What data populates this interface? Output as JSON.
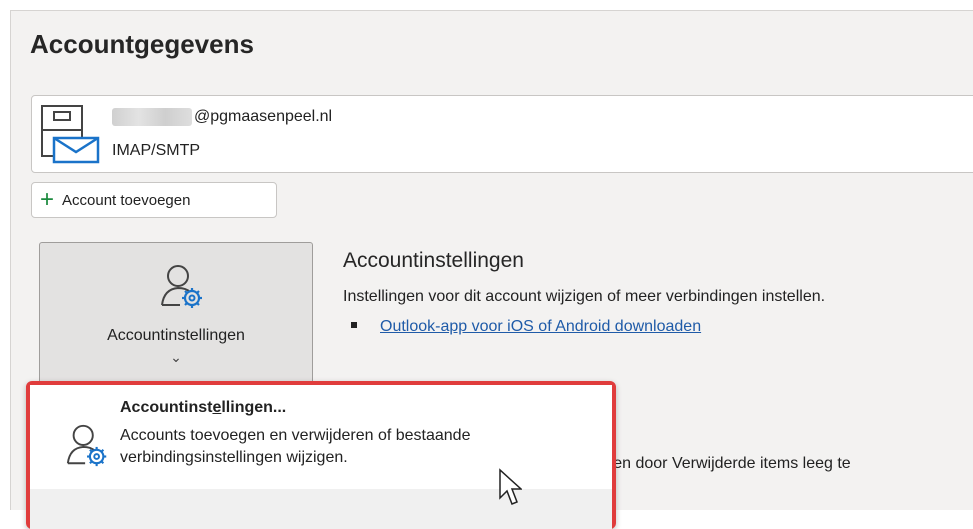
{
  "page": {
    "title": "Accountgegevens"
  },
  "account": {
    "email_suffix": "@pgmaasenpeel.nl",
    "type": "IMAP/SMTP"
  },
  "add_account": {
    "plus": "+",
    "label": "Account toevoegen"
  },
  "account_settings": {
    "button_label": "Accountinstellingen",
    "button_chevron": "⌄",
    "heading": "Accountinstellingen",
    "description": "Instellingen voor dit account wijzigen of meer verbindingen instellen.",
    "link_text": "Outlook-app voor iOS of Android downloaden"
  },
  "dropdown": {
    "item_title_pre": "Accountinst",
    "item_title_accel": "e",
    "item_title_post": "llingen...",
    "item_desc": "Accounts toevoegen en verwijderen of bestaande verbindingsinstellingen wijzigen."
  },
  "background_text": "eren door Verwijderde items leeg te",
  "colors": {
    "accent_blue": "#1f5ba8",
    "highlight_red": "#e03c3c",
    "plus_green": "#1c8b3f"
  },
  "icons": [
    "mailbox-icon",
    "account-settings-icon",
    "plus-icon",
    "chevron-down-icon",
    "mouse-cursor-icon"
  ]
}
